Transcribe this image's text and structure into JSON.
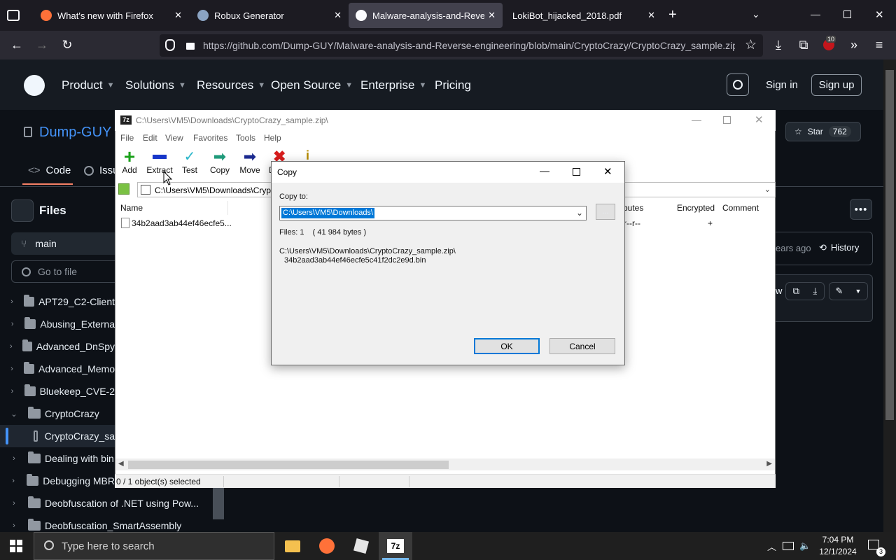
{
  "browser": {
    "tabs": [
      {
        "title": "What's new with Firefox"
      },
      {
        "title": "Robux Generator"
      },
      {
        "title": "Malware-analysis-and-Reverse-"
      },
      {
        "title": "LokiBot_hijacked_2018.pdf"
      }
    ],
    "url": "https://github.com/Dump-GUY/Malware-analysis-and-Reverse-engineering/blob/main/CryptoCrazy/CryptoCrazy_sample.zip",
    "extension_badge": "10"
  },
  "github": {
    "nav": [
      "Product",
      "Solutions",
      "Resources",
      "Open Source",
      "Enterprise",
      "Pricing"
    ],
    "sign_in": "Sign in",
    "sign_up": "Sign up",
    "repo_owner": "Dump-GUY /",
    "star_label": "Star",
    "star_count": "762",
    "tab_code": "Code",
    "tab_issues": "Issu",
    "files_title": "Files",
    "branch": "main",
    "goto_placeholder": "Go to file",
    "tree": [
      {
        "name": "APT29_C2-Client",
        "type": "folder",
        "expanded": false
      },
      {
        "name": "Abusing_Externa",
        "type": "folder",
        "expanded": false
      },
      {
        "name": "Advanced_DnSpy",
        "type": "folder",
        "expanded": false
      },
      {
        "name": "Advanced_Memo",
        "type": "folder",
        "expanded": false
      },
      {
        "name": "Bluekeep_CVE-2",
        "type": "folder",
        "expanded": false
      },
      {
        "name": "CryptoCrazy",
        "type": "folder",
        "expanded": true
      },
      {
        "name": "CryptoCrazy_sa",
        "type": "file",
        "selected": true
      },
      {
        "name": "Dealing with bin",
        "type": "folder",
        "expanded": false
      },
      {
        "name": "Debugging MBR",
        "type": "folder",
        "expanded": false
      },
      {
        "name": "Deobfuscation of .NET using Pow...",
        "type": "folder",
        "expanded": false
      },
      {
        "name": "Deobfuscation_SmartAssembly",
        "type": "folder",
        "expanded": false
      }
    ],
    "commit_age": "ears ago",
    "history": "History",
    "raw_fragment": "w"
  },
  "zip": {
    "title": "C:\\Users\\VM5\\Downloads\\CryptoCrazy_sample.zip\\",
    "menu": [
      "File",
      "Edit",
      "View",
      "Favorites",
      "Tools",
      "Help"
    ],
    "toolbar": [
      "Add",
      "Extract",
      "Test",
      "Copy",
      "Move",
      "D"
    ],
    "address": "C:\\Users\\VM5\\Downloads\\Cryp",
    "columns": {
      "name": "Name",
      "attributes": "butes",
      "encrypted": "Encrypted",
      "comment": "Comment"
    },
    "row": {
      "name": "34b2aad3ab44ef46ecfe5...",
      "attributes": "r--r--",
      "encrypted": "+"
    },
    "status": "0 / 1 object(s) selected"
  },
  "dialog": {
    "title": "Copy",
    "copy_to_label": "Copy to:",
    "path": "C:\\Users\\VM5\\Downloads\\",
    "browse": "...",
    "files_info": "Files: 1    ( 41 984 bytes )",
    "source_line1": "C:\\Users\\VM5\\Downloads\\CryptoCrazy_sample.zip\\",
    "source_line2": "34b2aad3ab44ef46ecfe5c41f2dc2e9d.bin",
    "ok": "OK",
    "cancel": "Cancel"
  },
  "taskbar": {
    "search_placeholder": "Type here to search",
    "time": "7:04 PM",
    "date": "12/1/2024",
    "notifications": "3"
  },
  "colors": {
    "accent_github": "#0d1117",
    "link_blue": "#4493f8",
    "selection": "#0078d7"
  }
}
